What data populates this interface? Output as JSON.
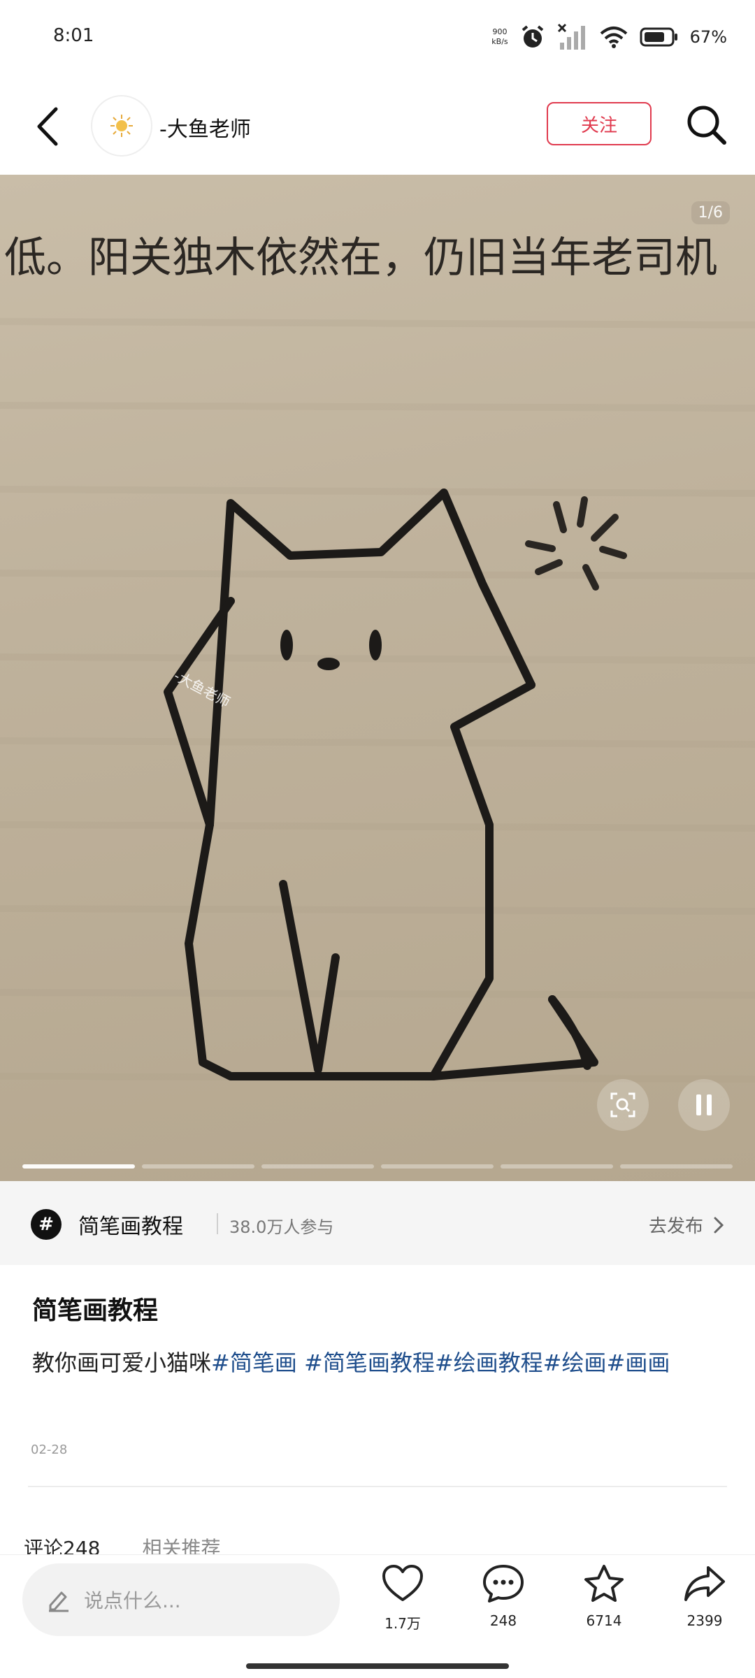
{
  "status_bar": {
    "time": "8:01",
    "net_speed_value": "900",
    "net_speed_unit": "kB/s",
    "battery": "67%"
  },
  "header": {
    "author": "-大鱼老师",
    "follow_label": "关注"
  },
  "media": {
    "book_text": "低。阳关独木依然在，仍旧当年老司机",
    "page_indicator": "1/6",
    "watermark": "-大鱼老师",
    "progress": {
      "segments": 6,
      "active_index": 0
    }
  },
  "topic": {
    "name": "简笔画教程",
    "participants": "38.0万人参与",
    "action_label": "去发布"
  },
  "post": {
    "title": "简笔画教程",
    "desc_text": "教你画可爱小猫咪",
    "hashtags": [
      "#简笔画 ",
      "#简笔画教程",
      "#绘画教程",
      "#绘画",
      "#画画"
    ],
    "date": "02-28"
  },
  "tabs": {
    "comments": "评论248",
    "related": "相关推荐"
  },
  "bottom": {
    "placeholder": "说点什么...",
    "likes": "1.7万",
    "comments": "248",
    "favorites": "6714",
    "shares": "2399"
  },
  "colors": {
    "accent": "#e03a4e",
    "tag": "#1f4e8c"
  }
}
